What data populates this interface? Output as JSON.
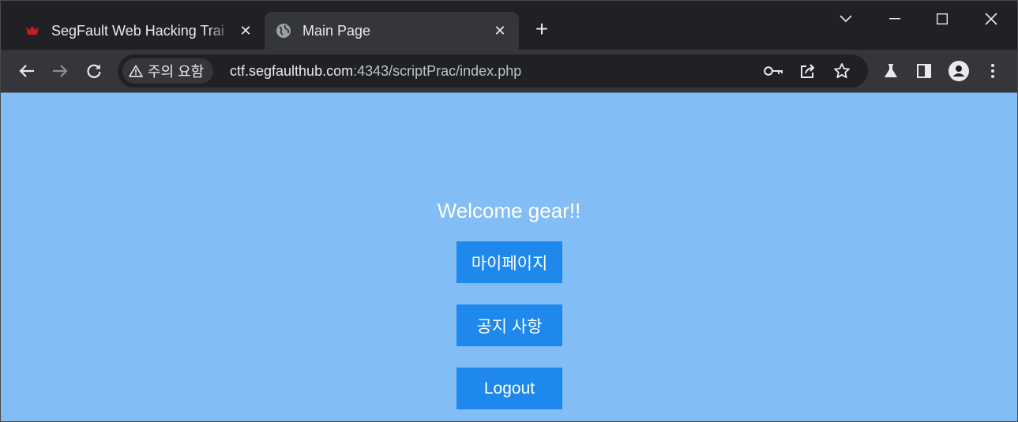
{
  "tabs": [
    {
      "title": "SegFault Web Hacking Trai",
      "favicon": "segfault-logo-icon",
      "close": "✕"
    },
    {
      "title": "Main Page",
      "favicon": "globe-icon",
      "close": "✕"
    }
  ],
  "new_tab_label": "+",
  "security_chip": {
    "icon": "warning-triangle-icon",
    "label": "주의 요함"
  },
  "address": {
    "host": "ctf.segfaulthub.com",
    "path": ":4343/scriptPrac/index.php"
  },
  "page": {
    "welcome": "Welcome gear!!",
    "buttons": {
      "mypage": "마이페이지",
      "notice": "공지 사항",
      "logout": "Logout"
    },
    "background_color": "#83bdf5",
    "button_color": "#1e88ec"
  }
}
